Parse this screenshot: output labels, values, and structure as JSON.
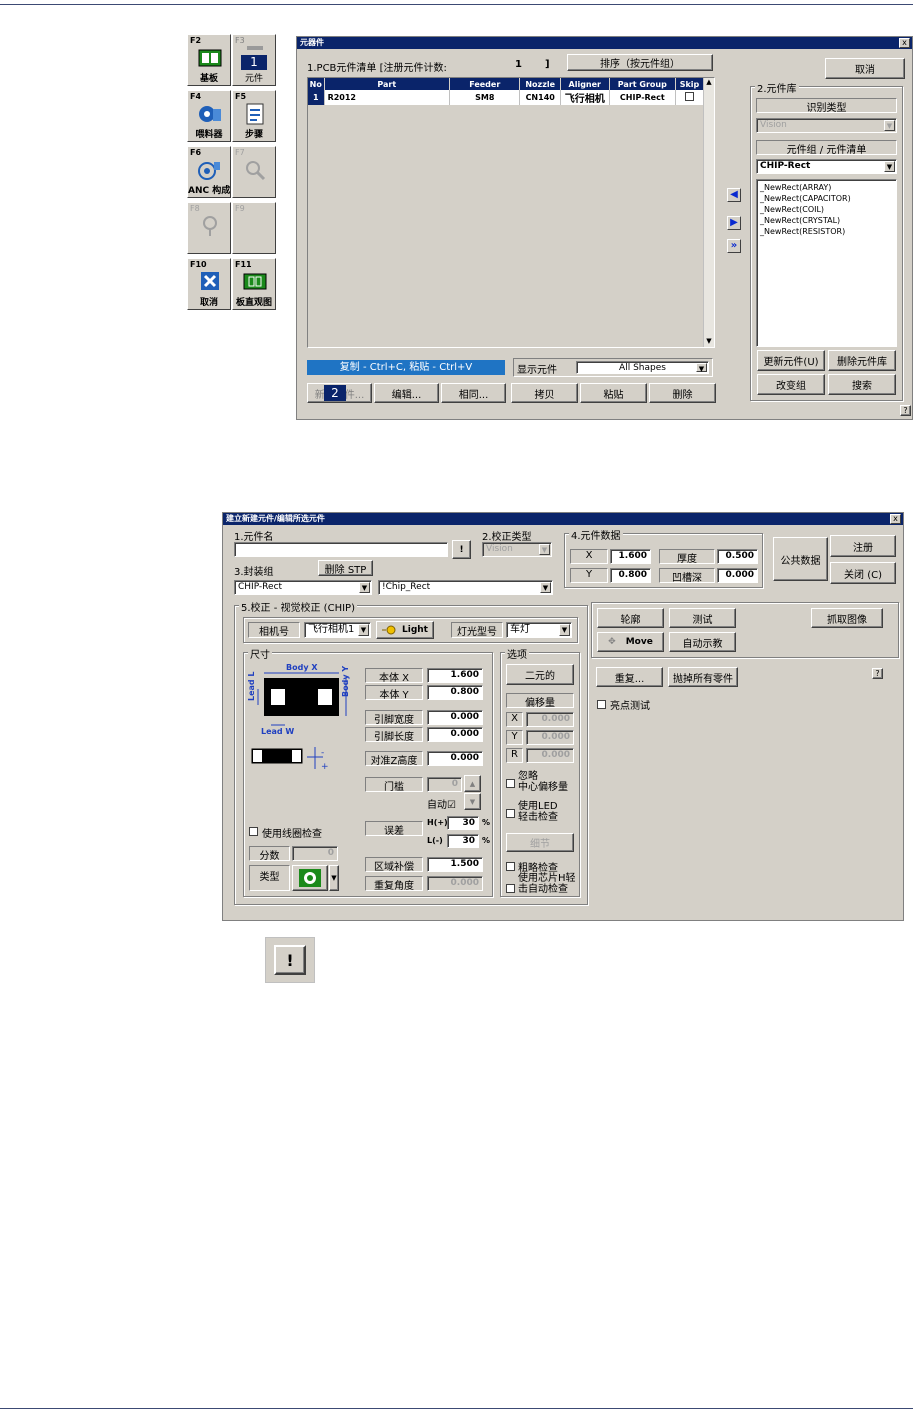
{
  "fkeys": [
    {
      "key": "F2",
      "label": "基板",
      "icon": "board-icon"
    },
    {
      "key": "F3",
      "label": "元件",
      "icon": "component-icon",
      "callout": "1"
    },
    {
      "key": "F4",
      "label": "喂料器",
      "icon": "feeder-icon"
    },
    {
      "key": "F5",
      "label": "步骤",
      "icon": "steps-icon"
    },
    {
      "key": "F6",
      "label": "ANC 构成",
      "icon": "anc-icon"
    },
    {
      "key": "F7",
      "label": "",
      "icon": "search-icon"
    },
    {
      "key": "F8",
      "label": "",
      "icon": "vision-icon"
    },
    {
      "key": "F9",
      "label": "",
      "icon": ""
    },
    {
      "key": "F10",
      "label": "取消",
      "icon": "cancel-icon"
    },
    {
      "key": "F11",
      "label": "板直观图",
      "icon": "board-view-icon"
    }
  ],
  "comp_win": {
    "title": "元器件",
    "close": "x",
    "list_header": "1.PCB元件清单 [注册元件计数:",
    "count": "1",
    "count_close": "]",
    "sort_btn": "排序（按元件组）",
    "cancel_btn": "取消",
    "columns": [
      "No",
      "Part",
      "Feeder",
      "Nozzle",
      "Aligner",
      "Part Group",
      "Skip"
    ],
    "rows": [
      {
        "no": "1",
        "part": "R2012",
        "feeder": "SM8",
        "nozzle": "CN140",
        "aligner": "飞行相机",
        "group": "CHIP-Rect"
      }
    ],
    "lib_title": "2.元件库",
    "recog_label": "识别类型",
    "recog_value": "Vision",
    "group_label": "元件组 / 元件清单",
    "group_value": "CHIP-Rect",
    "lib_items": [
      "_NewRect(ARRAY)",
      "_NewRect(CAPACITOR)",
      "_NewRect(COIL)",
      "_NewRect(CRYSTAL)",
      "_NewRect(RESISTOR)"
    ],
    "copy_hint": "复制 - Ctrl+C, 粘贴 - Ctrl+V",
    "show_label": "显示元件",
    "show_value": "All Shapes",
    "btn_new": "新建元件...",
    "callout2": "2",
    "btn_edit": "编辑...",
    "btn_same": "相同...",
    "btn_copy": "拷贝",
    "btn_paste": "粘贴",
    "btn_delete": "删除",
    "btn_update": "更新元件(U)",
    "btn_del_lib": "删除元件库",
    "btn_change_group": "改变组",
    "btn_search": "搜索",
    "help": "?"
  },
  "edit_win": {
    "title": "建立新建元件/编辑所选元件",
    "close": "x",
    "name_label": "1.元件名",
    "name_value": "",
    "name_btn": "!",
    "align_label": "2.校正类型",
    "align_value": "Vision",
    "data_label": "4.元件数据",
    "x_label": "X",
    "x_value": "1.600",
    "thick_label": "厚度",
    "thick_value": "0.500",
    "y_label": "Y",
    "y_value": "0.800",
    "groove_label": "凹槽深",
    "groove_value": "0.000",
    "public_btn": "公共数据",
    "register_btn": "注册",
    "close_btn": "关闭 (C)",
    "pkg_label": "3.封装组",
    "del_stp": "删除 STP",
    "pkg_value": "CHIP-Rect",
    "pkg_value2": "!Chip_Rect",
    "vision_title": "5.校正 - 视觉校正 (CHIP)",
    "cam_label": "相机号",
    "cam_value": "飞行相机1",
    "light_btn": "Light",
    "lamp_label": "灯光型号",
    "lamp_value": "车灯",
    "dim_title": "尺寸",
    "body_x_lbl": "Body X",
    "body_y_lbl": "Body Y",
    "lead_l_lbl": "Lead L",
    "lead_w_lbl": "Lead W",
    "dims": [
      {
        "label": "本体 X",
        "value": "1.600"
      },
      {
        "label": "本体 Y",
        "value": "0.800"
      },
      {
        "label": "引脚宽度",
        "value": "0.000"
      },
      {
        "label": "引脚长度",
        "value": "0.000"
      },
      {
        "label": "对准Z高度",
        "value": "0.000"
      }
    ],
    "threshold_label": "门槛",
    "threshold_value": "0",
    "auto_label": "自动☑",
    "tol_label": "误差",
    "h_label": "H(+)",
    "h_value": "30",
    "l_label": "L(-)",
    "l_value": "30",
    "pct": "%",
    "area_label": "区域补偿",
    "area_value": "1.500",
    "repeat_label": "重复角度",
    "repeat_value": "0.000",
    "coil_chk": "使用线圈检查",
    "score_label": "分数",
    "score_value": "0",
    "type_label": "类型",
    "opt_title": "选项",
    "opt_binary": "二元的",
    "opt_offset": "偏移量",
    "off_x": "0.000",
    "off_y": "0.000",
    "off_r": "0.000",
    "off_x_lbl": "X",
    "off_y_lbl": "Y",
    "off_r_lbl": "R",
    "ignore_chk": "忽略\n中心偏移量",
    "led_chk": "使用LED\n轻击检查",
    "detail_btn": "细节",
    "rough_chk": "粗略检查",
    "chip_chk": "使用芯片H轻\n击自动检查",
    "outline_btn": "轮廓",
    "test_btn": "测试",
    "grab_btn": "抓取图像",
    "move_btn": "Move",
    "auto_teach_btn": "自动示教",
    "repeat_btn": "重复...",
    "throw_btn": "抛掉所有零件",
    "bright_chk": "亮点测试",
    "help": "?"
  },
  "bottom_icon": "!"
}
